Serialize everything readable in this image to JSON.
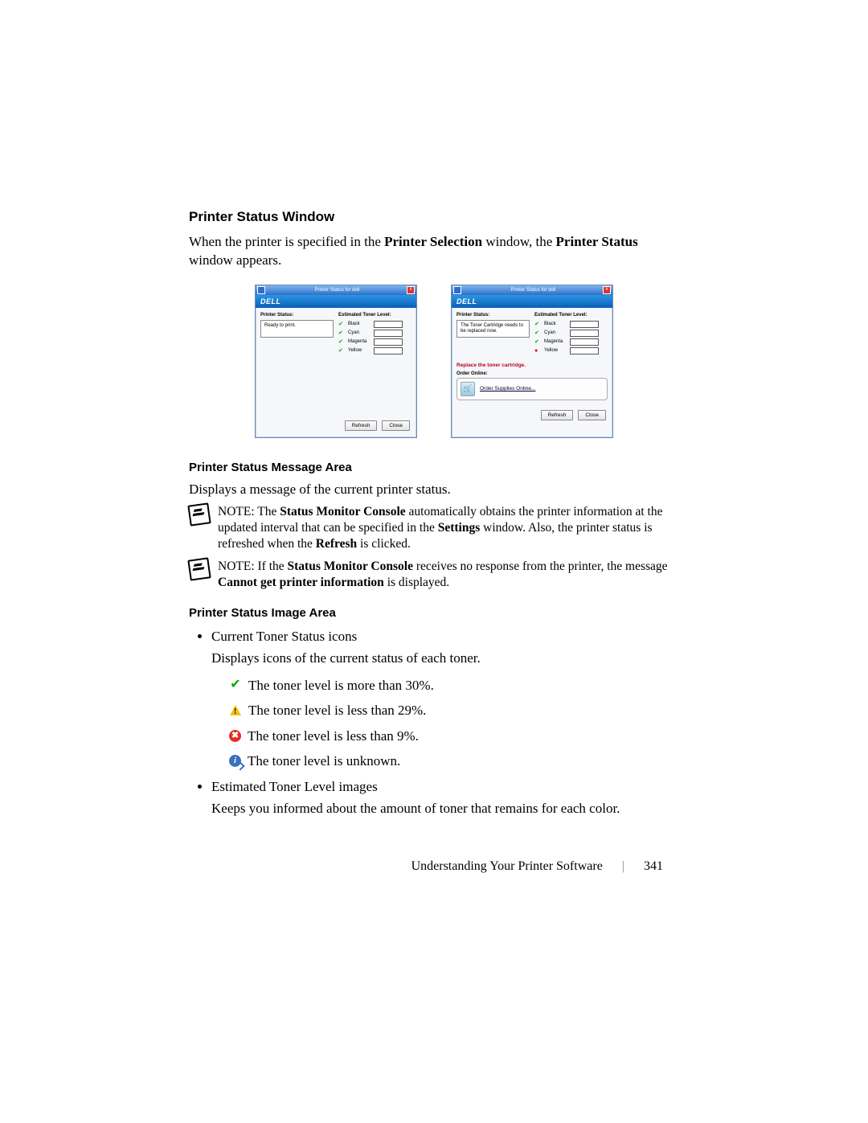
{
  "headings": {
    "h1": "Printer Status Window",
    "h2": "Printer Status Message Area",
    "h3": "Printer Status Image Area"
  },
  "intro": {
    "p1a": "When the printer is specified in the ",
    "p1b": "Printer Selection",
    "p1c": " window, the ",
    "p1d": "Printer Status",
    "p1e": " window appears."
  },
  "window": {
    "title": "Printer Status for dell",
    "logo": "DELL",
    "status_label": "Printer Status:",
    "toner_label": "Estimated Toner Level:",
    "ready_msg": "Ready to print.",
    "warn_msg": "The Toner Cartridge needs to be replaced now.",
    "toners": {
      "black": "Black",
      "cyan": "Cyan",
      "magenta": "Magenta",
      "yellow": "Yellow"
    },
    "replace_msg": "Replace the toner cartridge.",
    "order_label": "Order Online:",
    "order_link": "Order Supplies Online...",
    "refresh": "Refresh",
    "close": "Close"
  },
  "msg_area": {
    "p": "Displays a message of the current printer status.",
    "note1_a": "NOTE: The ",
    "note1_b": "Status Monitor Console",
    "note1_c": " automatically obtains the printer information at the updated interval that can be specified in the ",
    "note1_d": "Settings",
    "note1_e": " window. Also, the printer status is refreshed when the ",
    "note1_f": "Refresh",
    "note1_g": " is clicked.",
    "note2_a": "NOTE: If the ",
    "note2_b": "Status Monitor Console",
    "note2_c": " receives no response from the printer, the message ",
    "note2_d": "Cannot get printer information",
    "note2_e": " is displayed."
  },
  "image_area": {
    "li1": "Current Toner Status icons",
    "li1_desc": "Displays icons of the current status of each toner.",
    "r1": "The toner level is more than 30%.",
    "r2": "The toner level is less than 29%.",
    "r3": "The toner level is less than 9%.",
    "r4": "The toner level is unknown.",
    "li2": "Estimated Toner Level images",
    "li2_desc": "Keeps you informed about the amount of toner that remains for each color."
  },
  "footer": {
    "chapter": "Understanding Your Printer Software",
    "page": "341"
  }
}
